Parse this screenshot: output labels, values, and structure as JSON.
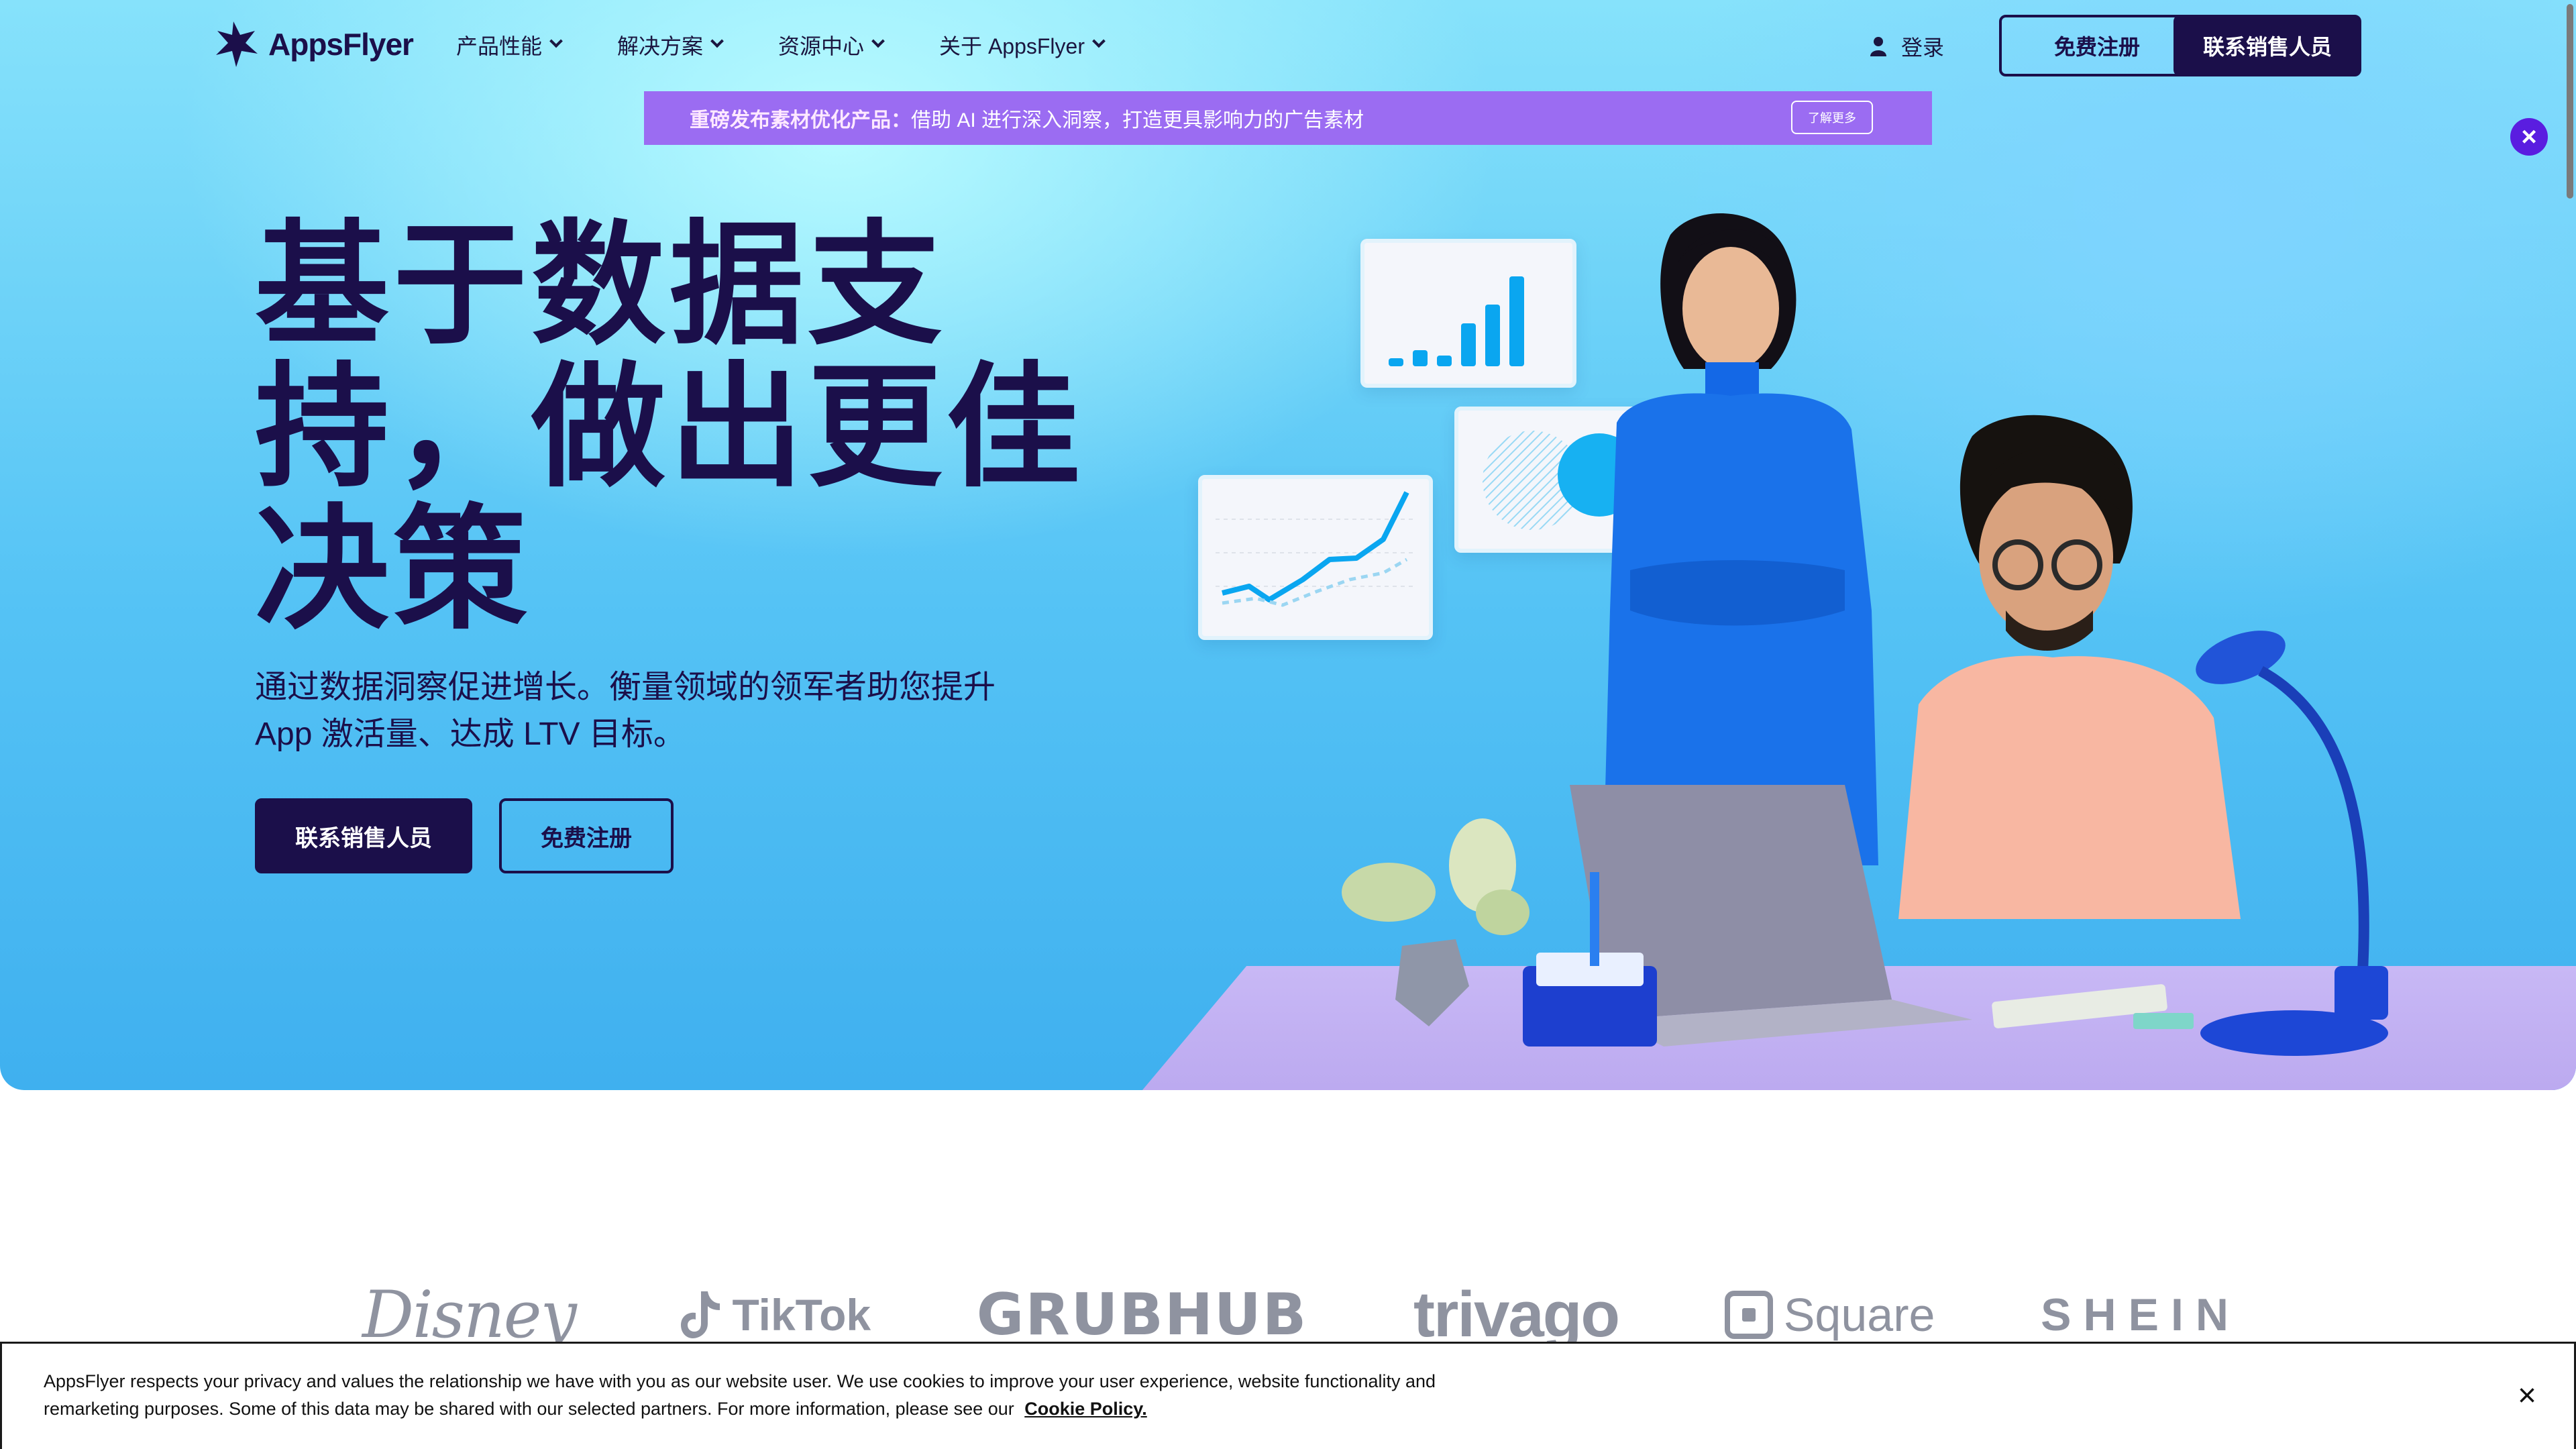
{
  "nav": {
    "logo_text": "AppsFlyer",
    "menu": [
      {
        "label": "产品性能"
      },
      {
        "label": "解决方案"
      },
      {
        "label": "资源中心"
      },
      {
        "label": "关于 AppsFlyer"
      }
    ],
    "login_label": "登录",
    "signup_label": "免费注册",
    "contact_label": "联系销售人员"
  },
  "banner": {
    "strong": "重磅发布素材优化产品：",
    "text": "借助 AI 进行深入洞察，打造更具影响力的广告素材",
    "button": "了解更多"
  },
  "hero": {
    "headline_lines": [
      "基于数据支",
      "持，做出更佳",
      "决策"
    ],
    "subtext": "通过数据洞察促进增长。衡量领域的领军者助您提升 App 激活量、达成 LTV 目标。",
    "contact_button": "联系销售人员",
    "signup_button": "免费注册"
  },
  "logos": [
    "Disney",
    "TikTok",
    "GRUBHUB",
    "trivago",
    "Square",
    "SHEIN"
  ],
  "cookie": {
    "text": "AppsFlyer respects your privacy and values the relationship we have with you as our website user. We use cookies to improve your user experience, website functionality and remarketing purposes. Some of this data may be shared with our selected partners. For more information, please see our",
    "link": "Cookie Policy.",
    "close": "×"
  },
  "colors": {
    "brand_dark": "#1b0f4a",
    "banner_purple": "#9b6cf2",
    "close_purple": "#5a1de0",
    "hero_blue": "#55c3f5",
    "accent_blue": "#0aa6f0"
  }
}
